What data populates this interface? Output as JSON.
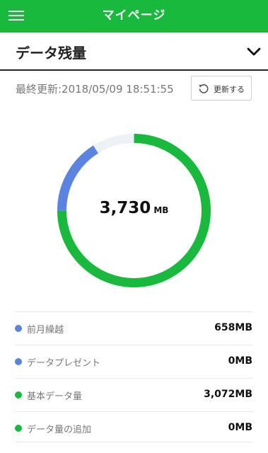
{
  "header": {
    "title": "マイページ",
    "menu_icon": "hamburger-menu-icon"
  },
  "section": {
    "title": "データ残量",
    "toggle_icon": "chevron-down-icon"
  },
  "update": {
    "label": "最終更新:2018/05/09 18:51:55",
    "refresh_label": "更新する",
    "refresh_icon": "refresh-icon"
  },
  "total": {
    "value": "3,730",
    "unit": "MB"
  },
  "colors": {
    "brand": "#19b93d",
    "carryover": "#5b84e0",
    "track": "#eef1f6"
  },
  "breakdown": [
    {
      "label": "前月繰越",
      "value": "658MB",
      "color": "#5b84e0"
    },
    {
      "label": "データプレゼント",
      "value": "0MB",
      "color": "#5b84e0"
    },
    {
      "label": "基本データ量",
      "value": "3,072MB",
      "color": "#19b93d"
    },
    {
      "label": "データ量の追加",
      "value": "0MB",
      "color": "#19b93d"
    }
  ],
  "chart_data": {
    "type": "pie",
    "categories": [
      "前月繰越",
      "基本データ量"
    ],
    "values": [
      658,
      3072
    ],
    "capacity": 4096,
    "series_colors": [
      "#5b84e0",
      "#19b93d"
    ],
    "center_label": "3,730 MB"
  }
}
